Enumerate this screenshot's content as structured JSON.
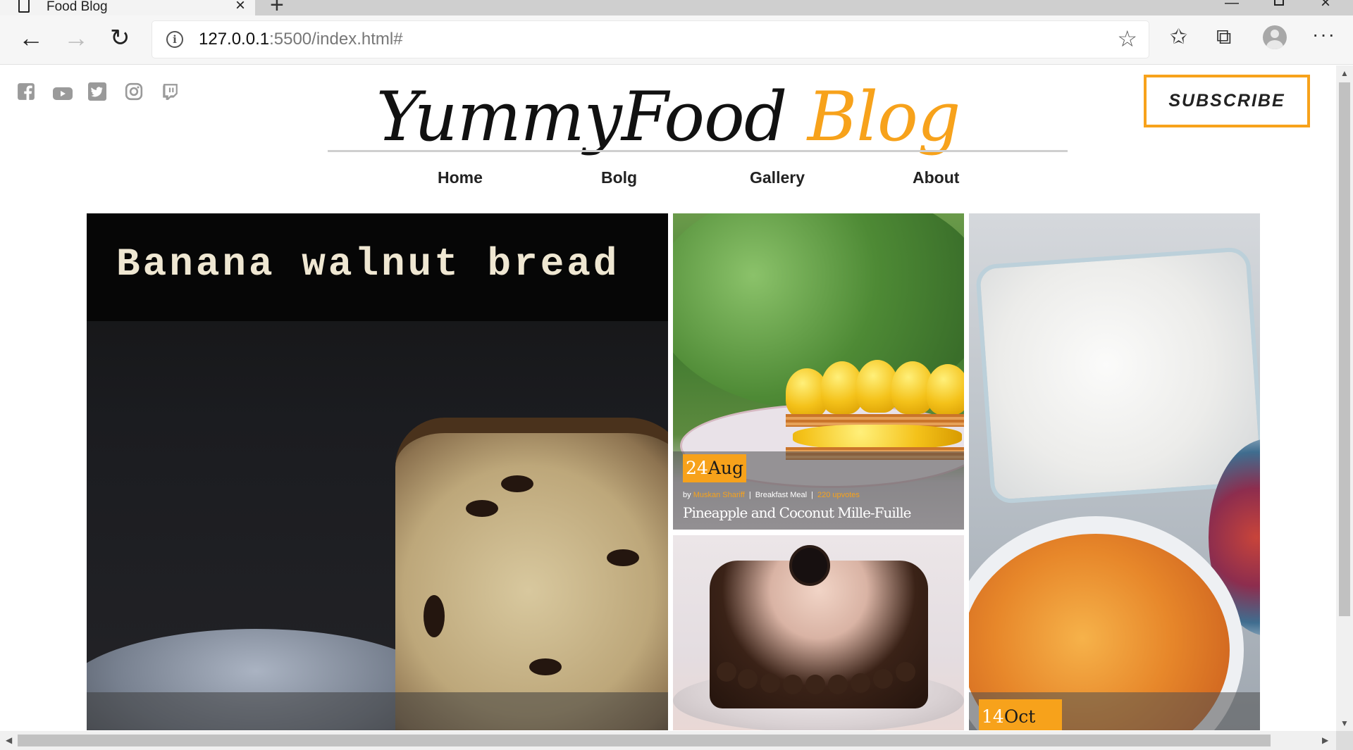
{
  "browser": {
    "tab_title": "Food Blog",
    "url_host": "127.0.0.1",
    "url_rest": ":5500/index.html#",
    "new_tab_label": "+",
    "close_tab_label": "×"
  },
  "icons": {
    "socials": [
      "facebook-icon",
      "youtube-icon",
      "twitter-icon",
      "instagram-icon",
      "twitch-icon"
    ],
    "toolbar": [
      "back-icon",
      "forward-icon",
      "reload-icon",
      "info-icon",
      "star-icon",
      "favorites-icon",
      "collections-icon",
      "profile-icon",
      "more-icon"
    ]
  },
  "header": {
    "brand_main": "YummyFood",
    "brand_accent": "Blog",
    "subscribe_label": "SUBSCRIBE"
  },
  "nav": {
    "home": "Home",
    "bolg": "Bolg",
    "gallery": "Gallery",
    "about": "About"
  },
  "colors": {
    "accent": "#f7a21b",
    "text": "#222222"
  },
  "cards": {
    "banana": {
      "title": "Banana walnut bread"
    },
    "mille": {
      "day": "24",
      "month": "Aug",
      "by": "by",
      "author": "Muskan Shariff",
      "category": "Breakfast Meal",
      "upvotes": "220 upvotes",
      "title": "Pineapple and Coconut Mille-Fuille"
    },
    "rice": {
      "day": "14",
      "month": "Oct"
    }
  }
}
